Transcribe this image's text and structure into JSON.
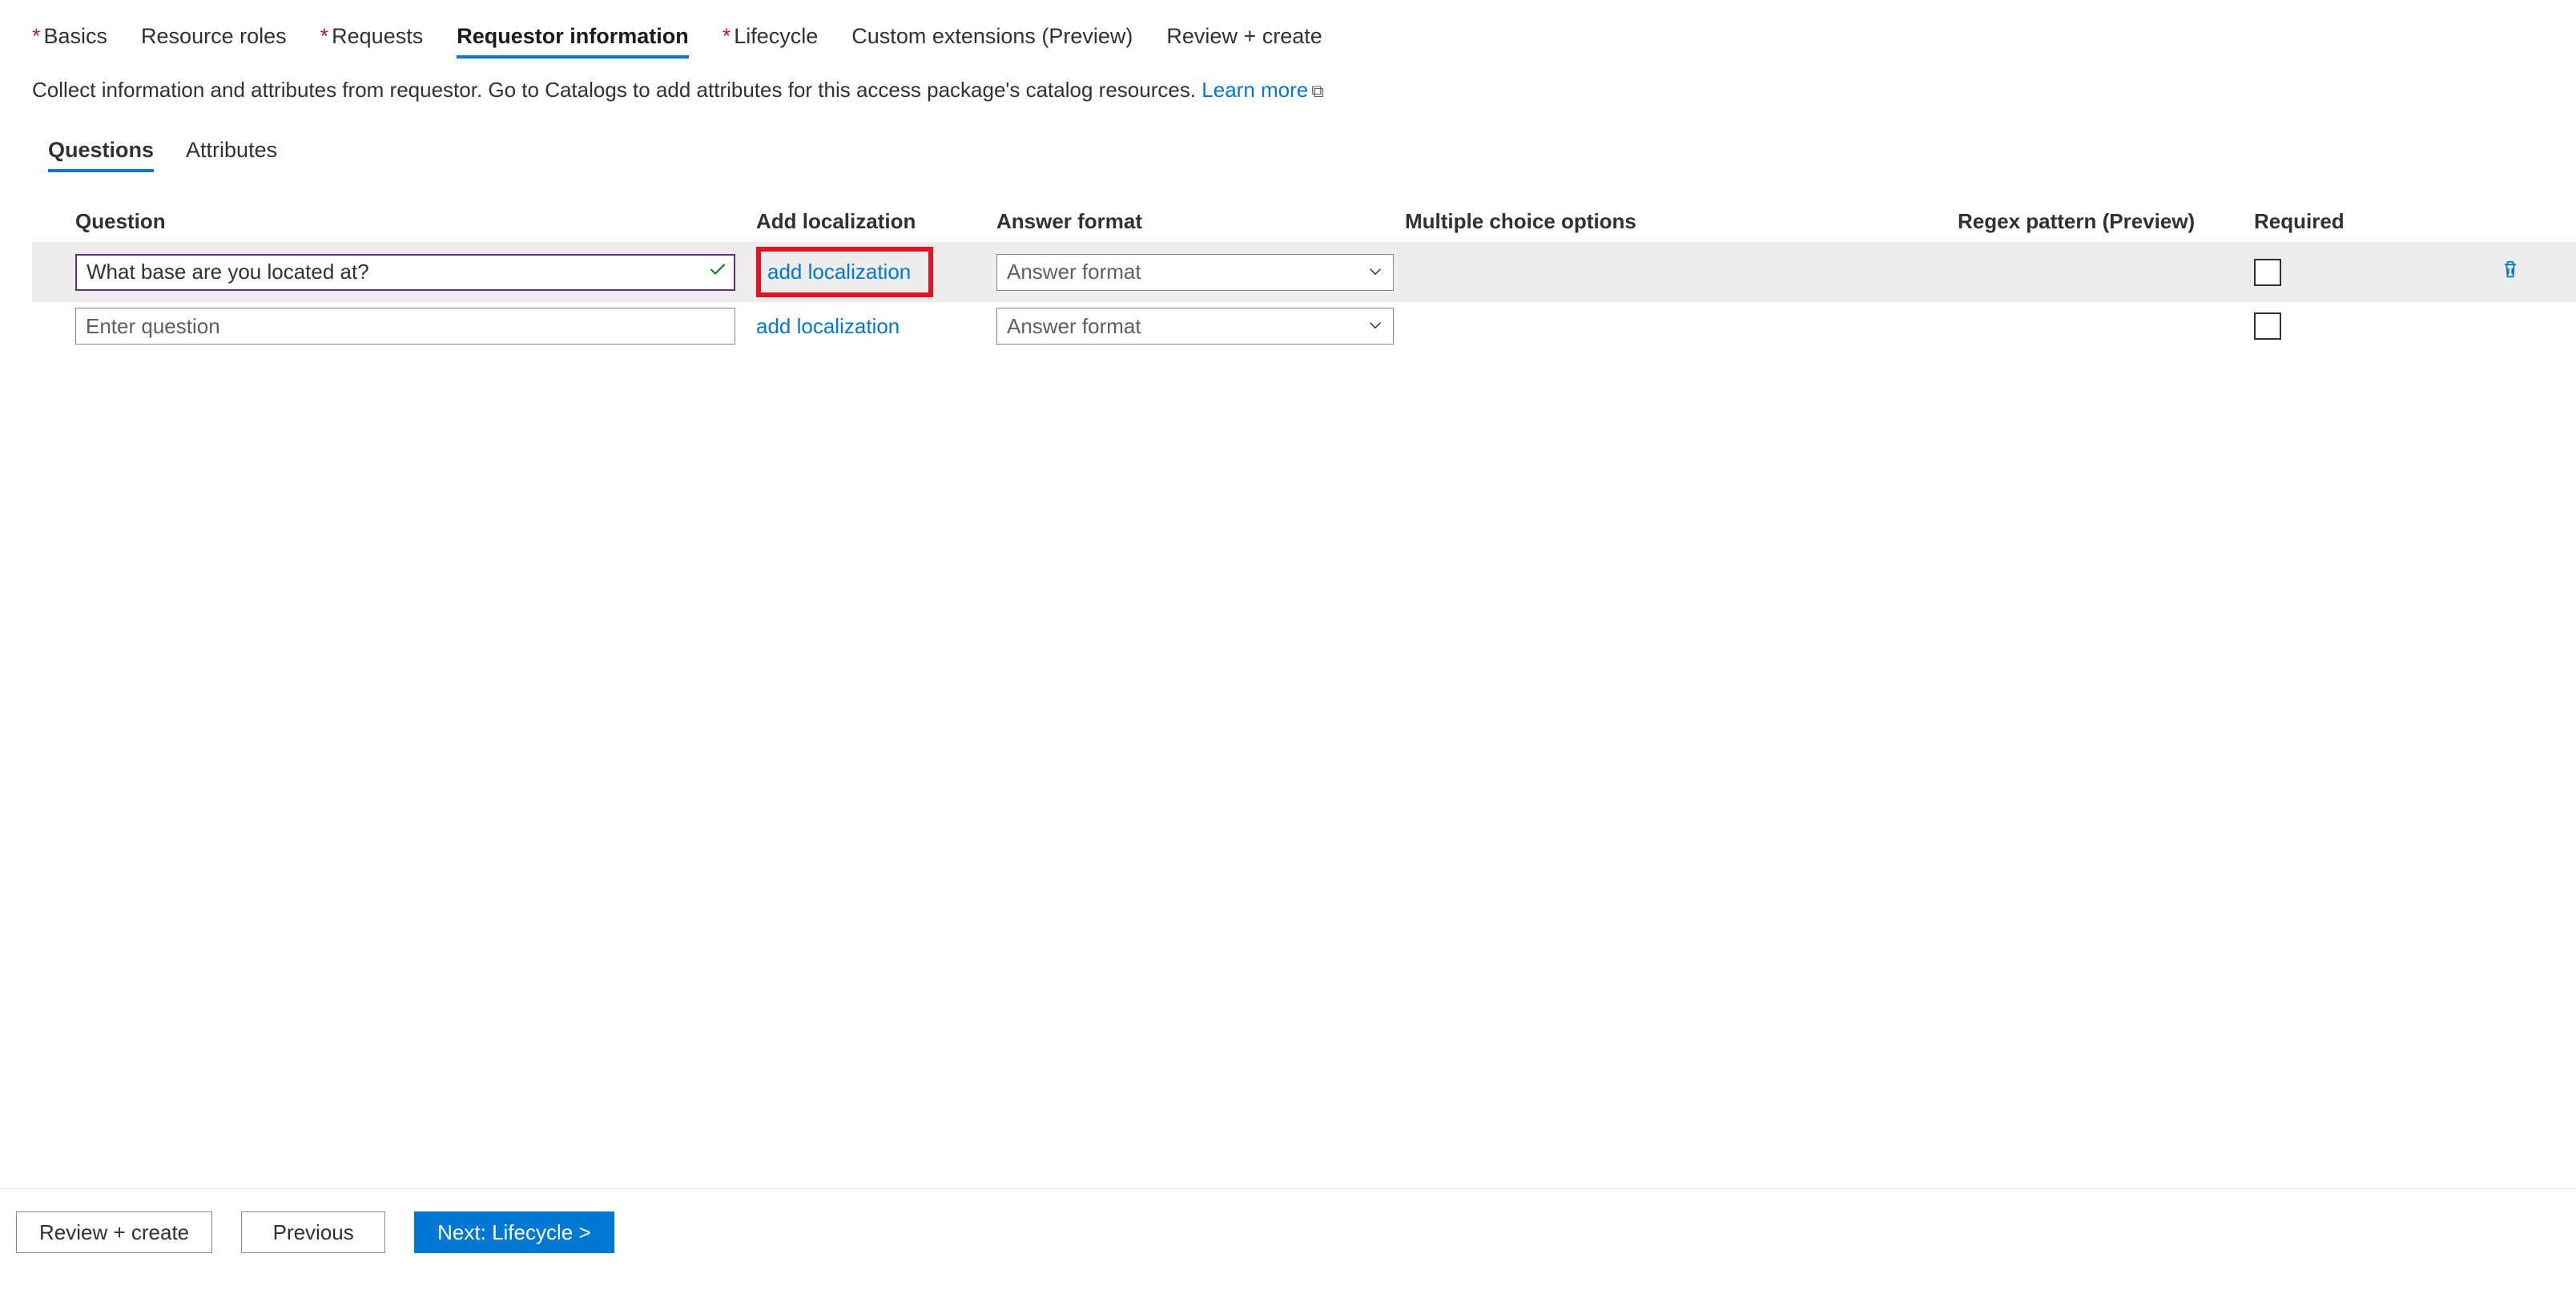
{
  "wizard_tabs": {
    "basics": "Basics",
    "resource_roles": "Resource roles",
    "requests": "Requests",
    "requestor_info": "Requestor information",
    "lifecycle": "Lifecycle",
    "custom_ext": "Custom extensions (Preview)",
    "review": "Review + create"
  },
  "description": "Collect information and attributes from requestor. Go to Catalogs to add attributes for this access package's catalog resources.",
  "learn_more": "Learn more",
  "subtabs": {
    "questions": "Questions",
    "attributes": "Attributes"
  },
  "columns": {
    "question": "Question",
    "add_loc": "Add localization",
    "answer_format": "Answer format",
    "mco": "Multiple choice options",
    "regex": "Regex pattern (Preview)",
    "required": "Required"
  },
  "rows": {
    "r0": {
      "question_value": "What base are you located at?",
      "loc_link": "add localization",
      "answer_format_placeholder": "Answer format"
    },
    "r1": {
      "question_placeholder": "Enter question",
      "loc_link": "add localization",
      "answer_format_placeholder": "Answer format"
    }
  },
  "footer": {
    "review": "Review + create",
    "previous": "Previous",
    "next": "Next: Lifecycle >"
  }
}
